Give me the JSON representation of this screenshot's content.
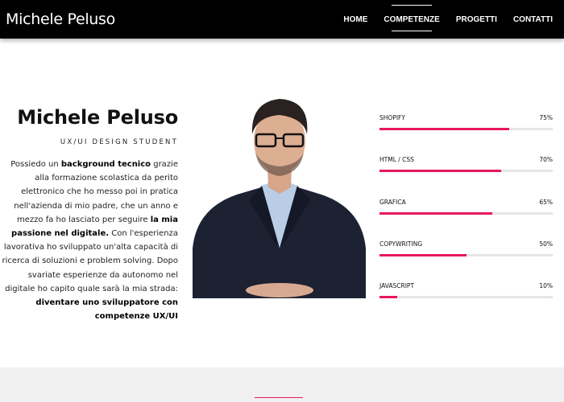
{
  "brand": "Michele Peluso",
  "nav": [
    {
      "label": "HOME",
      "active": false
    },
    {
      "label": "COMPETENZE",
      "active": true
    },
    {
      "label": "PROGETTI",
      "active": false
    },
    {
      "label": "CONTATTI",
      "active": false
    }
  ],
  "profile": {
    "name": "Michele Peluso",
    "role": "UX/UI DESIGN STUDENT",
    "bio": [
      {
        "text": "Possiedo un ",
        "bold": false
      },
      {
        "text": "background tecnico",
        "bold": true
      },
      {
        "text": " grazie alla formazione scolastica da perito elettronico che ho messo poi in pratica nell'azienda di mio padre, che un anno e mezzo fa ho lasciato per seguire ",
        "bold": false
      },
      {
        "text": "la mia passione nel digitale.",
        "bold": true
      },
      {
        "text": " Con l'esperienza lavorativa ho sviluppato un'alta capacità di ricerca di soluzioni e problem solving. Dopo svariate esperienze da autonomo nel digitale ho capito quale sarà la mia strada: ",
        "bold": false
      },
      {
        "text": "diventare uno sviluppatore con competenze UX/UI",
        "bold": true
      }
    ]
  },
  "skills": [
    {
      "label": "SHOPIFY",
      "percent_text": "75%",
      "value": 0.75
    },
    {
      "label": "HTML / CSS",
      "percent_text": "70%",
      "value": 0.7
    },
    {
      "label": "GRAFICA",
      "percent_text": "65%",
      "value": 0.65
    },
    {
      "label": "COPYWRITING",
      "percent_text": "50%",
      "value": 0.5
    },
    {
      "label": "JAVASCRIPT",
      "percent_text": "10%",
      "value": 0.1
    }
  ],
  "colors": {
    "accent": "#e8175d",
    "navbar": "#000000",
    "track": "#e5e5e5"
  },
  "icons": {
    "photo": "portrait-photo"
  }
}
